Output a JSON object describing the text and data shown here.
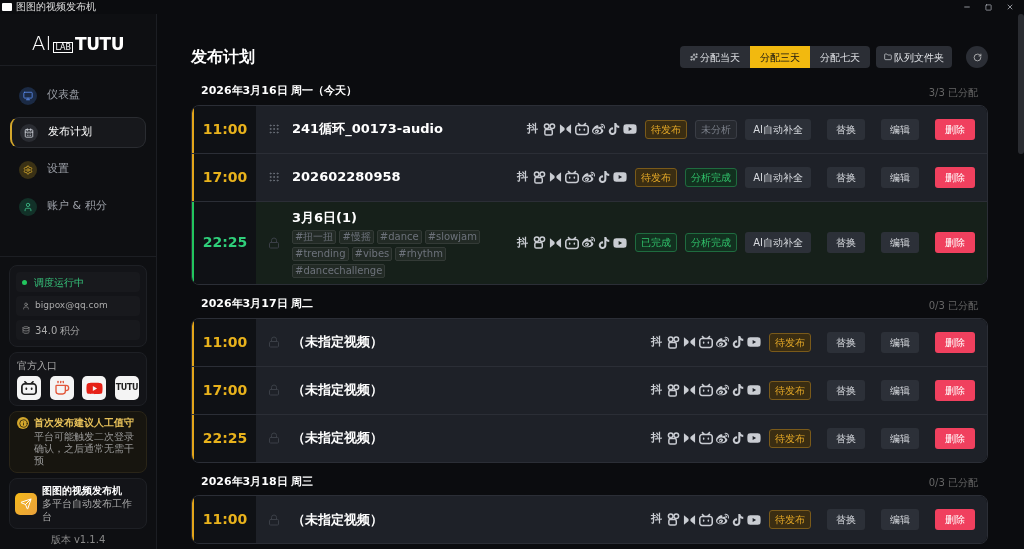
{
  "window": {
    "title": "图图的视频发布机"
  },
  "sidebar": {
    "logo": {
      "main": "AI",
      "sub": "LAB",
      "brand": "TUTU"
    },
    "nav": [
      {
        "label": "仪表盘",
        "selected": false
      },
      {
        "label": "发布计划",
        "selected": true
      },
      {
        "label": "设置",
        "selected": false
      },
      {
        "label": "账户 & 积分",
        "selected": false
      }
    ],
    "status": {
      "running": "调度运行中",
      "email": "bigpox@qq.com",
      "points": "34.0 积分"
    },
    "official": {
      "label": "官方入口",
      "tiles": [
        {
          "kind": "tv"
        },
        {
          "kind": "cup"
        },
        {
          "kind": "play"
        },
        {
          "kind": "text",
          "text": "TUTU"
        }
      ]
    },
    "notice": {
      "title": "首次发布建议人工值守",
      "body": "平台可能触发二次登录确认，之后通常无需干预"
    },
    "app": {
      "name": "图图的视频发布机",
      "subtitle": "多平台自动发布工作台"
    },
    "version": "版本 v1.1.4"
  },
  "main": {
    "title": "发布计划",
    "range": [
      {
        "label": "分配当天",
        "selected": false
      },
      {
        "label": "分配三天",
        "selected": true
      },
      {
        "label": "分配七天",
        "selected": false
      }
    ],
    "queue_button": "队列文件夹",
    "days": [
      {
        "date": "2026年3月16日 周一（今天）",
        "allocated": "3/3 已分配",
        "slots": [
          {
            "time": "11:00",
            "completed": false,
            "locked": false,
            "title": "241循环_00173-audio",
            "platform": "抖",
            "status": {
              "label": "待发布",
              "kind": "pending"
            },
            "analysis": {
              "label": "未分析",
              "kind": "none"
            },
            "ai": "AI自动补全",
            "replace": "替换",
            "edit": "编辑",
            "delete": "删除"
          },
          {
            "time": "17:00",
            "completed": false,
            "locked": false,
            "title": "202602280958",
            "platform": "抖",
            "status": {
              "label": "待发布",
              "kind": "pending"
            },
            "analysis": {
              "label": "分析完成",
              "kind": "done"
            },
            "ai": "AI自动补全",
            "replace": "替换",
            "edit": "编辑",
            "delete": "删除"
          },
          {
            "time": "22:25",
            "completed": true,
            "locked": true,
            "title": "3月6日(1)",
            "tags": [
              "#扭一扭",
              "#慢摇",
              "#dance",
              "#slowjam",
              "#trending",
              "#vibes",
              "#rhythm",
              "#dancechallenge"
            ],
            "platform": "抖",
            "status": {
              "label": "已完成",
              "kind": "done"
            },
            "analysis": {
              "label": "分析完成",
              "kind": "done"
            },
            "ai": "AI自动补全",
            "replace": "替换",
            "edit": "编辑",
            "delete": "删除"
          }
        ]
      },
      {
        "date": "2026年3月17日 周二",
        "allocated": "0/3 已分配",
        "slots": [
          {
            "time": "11:00",
            "completed": false,
            "locked": true,
            "title": "（未指定视频）",
            "platform": "抖",
            "status": {
              "label": "待发布",
              "kind": "pending"
            },
            "replace": "替换",
            "edit": "编辑",
            "delete": "删除"
          },
          {
            "time": "17:00",
            "completed": false,
            "locked": true,
            "title": "（未指定视频）",
            "platform": "抖",
            "status": {
              "label": "待发布",
              "kind": "pending"
            },
            "replace": "替换",
            "edit": "编辑",
            "delete": "删除"
          },
          {
            "time": "22:25",
            "completed": false,
            "locked": true,
            "title": "（未指定视频）",
            "platform": "抖",
            "status": {
              "label": "待发布",
              "kind": "pending"
            },
            "replace": "替换",
            "edit": "编辑",
            "delete": "删除"
          }
        ]
      },
      {
        "date": "2026年3月18日 周三",
        "allocated": "0/3 已分配",
        "slots": [
          {
            "time": "11:00",
            "completed": false,
            "locked": true,
            "title": "（未指定视频）",
            "platform": "抖",
            "status": {
              "label": "待发布",
              "kind": "pending"
            },
            "replace": "替换",
            "edit": "编辑",
            "delete": "删除"
          }
        ]
      }
    ]
  }
}
